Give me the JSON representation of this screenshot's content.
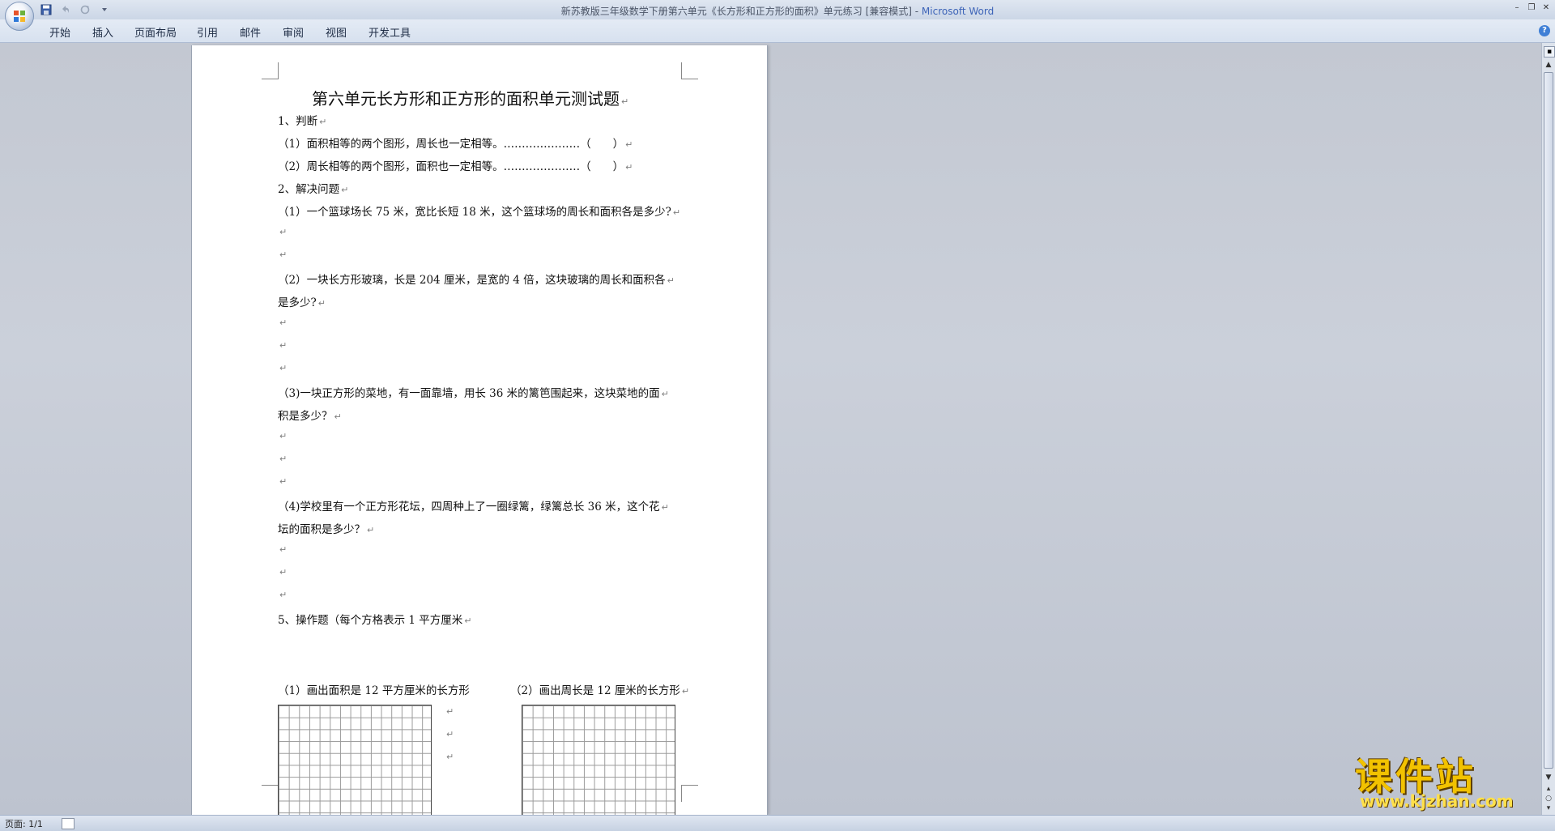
{
  "window": {
    "title": "新苏教版三年级数学下册第六单元《长方形和正方形的面积》单元练习 [兼容模式] - ",
    "app_name": "Microsoft Word"
  },
  "ribbon": {
    "tabs": [
      {
        "label": "开始"
      },
      {
        "label": "插入"
      },
      {
        "label": "页面布局"
      },
      {
        "label": "引用"
      },
      {
        "label": "邮件"
      },
      {
        "label": "审阅"
      },
      {
        "label": "视图"
      },
      {
        "label": "开发工具"
      }
    ]
  },
  "document": {
    "title": "第六单元长方形和正方形的面积单元测试题",
    "paragraph_mark": "↵",
    "lines": [
      "1、判断",
      "（1）面积相等的两个图形，周长也一定相等。…………………（　　）",
      "（2）周长相等的两个图形，面积也一定相等。…………………（　　）",
      "2、解决问题",
      "（1）一个篮球场长 75 米，宽比长短 18 米，这个篮球场的周长和面积各是多少?",
      "",
      "",
      "（2）一块长方形玻璃，长是 204 厘米，是宽的 4 倍，这块玻璃的周长和面积各",
      "是多少?",
      "",
      "",
      "",
      "（3)一块正方形的菜地，有一面靠墙，用长 36 米的篱笆围起来，这块菜地的面",
      "积是多少？",
      "",
      "",
      "",
      "（4)学校里有一个正方形花坛，四周种上了一圈绿篱，绿篱总长 36 米，这个花",
      "坛的面积是多少？",
      "",
      "",
      "",
      "5、操作题（每个方格表示 1 平方厘米"
    ],
    "operation_left": "（1）画出面积是 12 平方厘米的长方形",
    "operation_right": "（2）画出周长是 12 厘米的长方形"
  },
  "status": {
    "page": "页面: 1/1"
  },
  "watermark": {
    "text": "课件站",
    "url": "www.kjzhan.com"
  },
  "colors": {
    "title_app": "#3d64b8",
    "workspace": "#c9ced8",
    "watermark": "#f2c200"
  }
}
